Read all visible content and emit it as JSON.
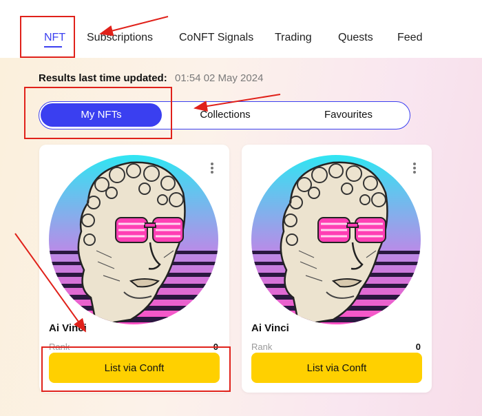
{
  "nav": {
    "tabs": [
      {
        "label": "NFT",
        "active": true
      },
      {
        "label": "Subscriptions"
      },
      {
        "label": "CoNFT Signals"
      },
      {
        "label": "Trading"
      },
      {
        "label": "Quests"
      },
      {
        "label": "Feed"
      }
    ]
  },
  "updated": {
    "label": "Results last time updated:",
    "value": "01:54 02 May 2024"
  },
  "segments": [
    {
      "label": "My NFTs",
      "active": true
    },
    {
      "label": "Collections"
    },
    {
      "label": "Favourites"
    }
  ],
  "cards": [
    {
      "name": "Ai Vinci",
      "rank_label": "Rank",
      "rank_value": "0",
      "button_label": "List via Conft",
      "image": "ai-vinci-statue-synthwave"
    },
    {
      "name": "Ai Vinci",
      "rank_label": "Rank",
      "rank_value": "0",
      "button_label": "List via Conft",
      "image": "ai-vinci-statue-synthwave"
    }
  ],
  "colors": {
    "accent": "#3a3ff0",
    "button": "#ffd000",
    "annotation": "#e0211a"
  },
  "icons": [
    "more-vert-icon"
  ]
}
